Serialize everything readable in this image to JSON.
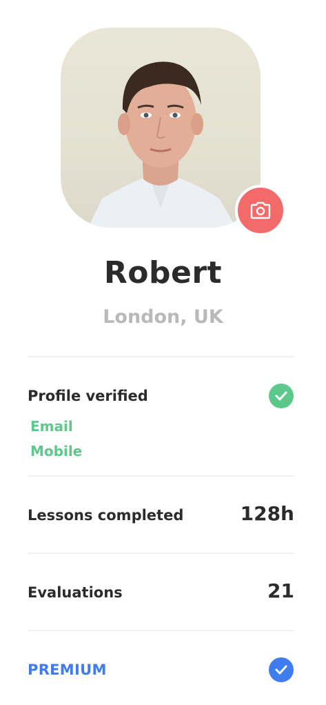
{
  "profile": {
    "name": "Robert",
    "location": "London, UK"
  },
  "verification": {
    "label": "Profile verified",
    "items": [
      "Email",
      "Mobile"
    ],
    "status_icon": "check-circle-icon",
    "color": "#5cc98a"
  },
  "stats": [
    {
      "label": "Lessons completed",
      "value": "128h"
    },
    {
      "label": "Evaluations",
      "value": "21"
    }
  ],
  "membership": {
    "label": "PREMIUM",
    "status_icon": "check-circle-icon",
    "color": "#3e7cf0"
  },
  "camera": {
    "icon": "camera-icon",
    "color": "#f26a6a"
  }
}
